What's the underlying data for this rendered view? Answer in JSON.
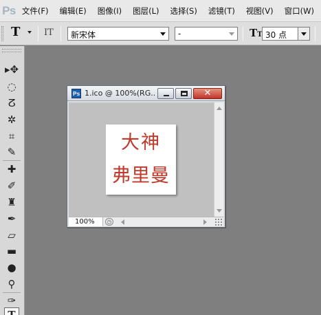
{
  "app": {
    "logo": "Ps"
  },
  "menu": [
    "文件(F)",
    "编辑(E)",
    "图像(I)",
    "图层(L)",
    "选择(S)",
    "滤镜(T)",
    "视图(V)",
    "窗口(W)"
  ],
  "options": {
    "tool_glyph": "T",
    "orient_glyph": "IT",
    "font_family": "新宋体",
    "font_style": "-",
    "size_glyph": "T",
    "font_size": "30 点"
  },
  "tools": [
    {
      "icon": "move-icon",
      "glyph": "▸✥"
    },
    {
      "icon": "marquee-icon",
      "glyph": "◌"
    },
    {
      "icon": "lasso-icon",
      "glyph": "ⵒ"
    },
    {
      "icon": "quick-select-icon",
      "glyph": "✲"
    },
    {
      "icon": "crop-icon",
      "glyph": "⌗"
    },
    {
      "icon": "eyedropper-icon",
      "glyph": "✎"
    },
    {
      "icon": "healing-icon",
      "glyph": "✚"
    },
    {
      "icon": "brush-icon",
      "glyph": "✐"
    },
    {
      "icon": "stamp-icon",
      "glyph": "♜"
    },
    {
      "icon": "history-brush-icon",
      "glyph": "✒"
    },
    {
      "icon": "eraser-icon",
      "glyph": "▱"
    },
    {
      "icon": "gradient-icon",
      "glyph": "▬"
    },
    {
      "icon": "blur-icon",
      "glyph": "●"
    },
    {
      "icon": "dodge-icon",
      "glyph": "⚲"
    },
    {
      "icon": "pen-icon",
      "glyph": "✑"
    },
    {
      "icon": "type-icon",
      "glyph": "T"
    }
  ],
  "document": {
    "title": "1.ico @ 100%(RG...",
    "close_glyph": "✕",
    "zoom": "100%",
    "image_text_line1": "大神",
    "image_text_line2": "弗里曼"
  },
  "colors": {
    "workspace": "#7f7f7f",
    "image_text": "#c0392b",
    "close_button": "#c2352a"
  }
}
